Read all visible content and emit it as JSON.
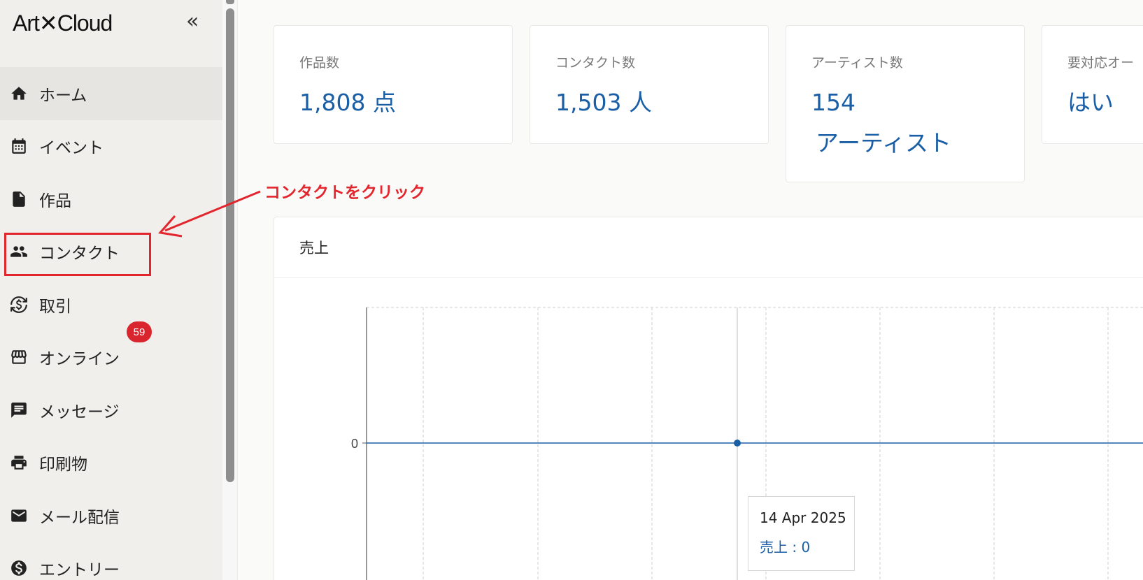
{
  "app": {
    "logo": "Art✕Cloud",
    "collapse_glyph": "«"
  },
  "sidebar": {
    "items": [
      {
        "label": "ホーム",
        "icon": "home-icon",
        "active": true
      },
      {
        "label": "イベント",
        "icon": "calendar-icon",
        "active": false
      },
      {
        "label": "作品",
        "icon": "document-icon",
        "active": false
      },
      {
        "label": "コンタクト",
        "icon": "people-icon",
        "active": false
      },
      {
        "label": "取引",
        "icon": "currency-exchange-icon",
        "active": false
      },
      {
        "label": "オンライン",
        "icon": "storefront-icon",
        "active": false
      },
      {
        "label": "メッセージ",
        "icon": "message-icon",
        "active": false
      },
      {
        "label": "印刷物",
        "icon": "printer-icon",
        "active": false
      },
      {
        "label": "メール配信",
        "icon": "mail-icon",
        "active": false
      },
      {
        "label": "エントリー",
        "icon": "dollar-circle-icon",
        "active": false
      }
    ],
    "message_badge": "59"
  },
  "annotation": {
    "text": "コンタクトをクリック",
    "color": "#e3262d"
  },
  "stats": [
    {
      "title": "作品数",
      "value": "1,808 点"
    },
    {
      "title": "コンタクト数",
      "value": "1,503 人"
    },
    {
      "title": "アーティスト数",
      "value": "154",
      "value_line2": "アーティスト"
    },
    {
      "title": "要対応オー",
      "value": "はい"
    }
  ],
  "sales": {
    "title": "売上",
    "tooltip": {
      "date": "14 Apr 2025",
      "value": "売上 : 0"
    }
  },
  "chart_data": {
    "type": "line",
    "title": "",
    "y_tick_labels": [
      "0"
    ],
    "series": [
      {
        "values": [
          0,
          0,
          0,
          0,
          0,
          0,
          0,
          0,
          0,
          0,
          0,
          0,
          0
        ]
      }
    ],
    "highlighted_point": {
      "x": "14 Apr 2025",
      "y": 0
    },
    "grid": true,
    "color": "#1a5fa6"
  },
  "colors": {
    "accent": "#1a5fa6",
    "badge": "#d9262e",
    "sidebar_bg": "#f0efeb"
  }
}
